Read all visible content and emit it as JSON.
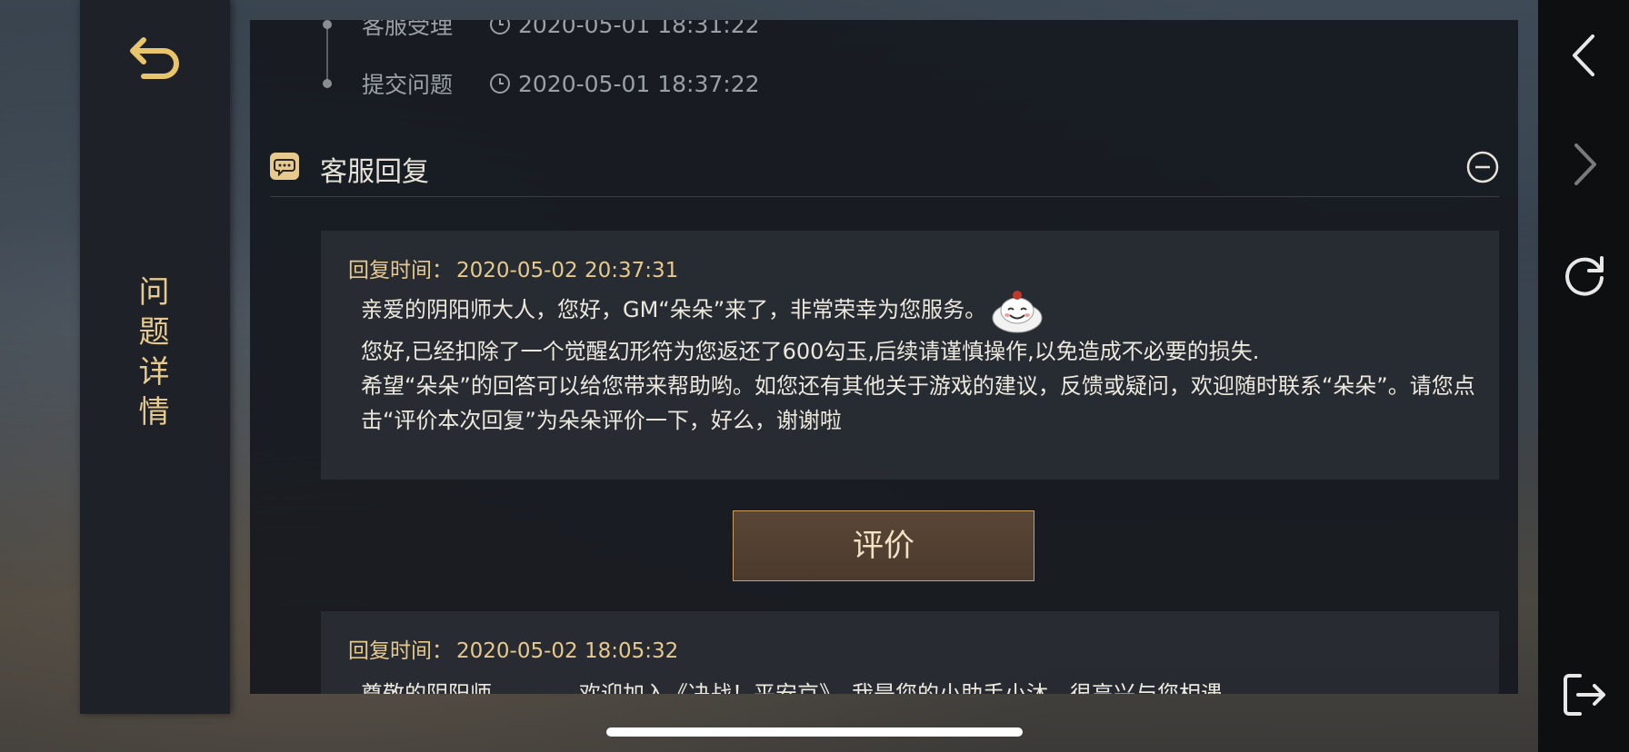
{
  "left_nav": {
    "back_icon": "back-arrow-icon",
    "title_chars": [
      "问",
      "题",
      "详",
      "情"
    ]
  },
  "timeline": {
    "items": [
      {
        "label": "客服受理",
        "time": "2020-05-01 18:31:22"
      },
      {
        "label": "提交问题",
        "time": "2020-05-01 18:37:22"
      }
    ]
  },
  "section": {
    "title": "客服回复",
    "icon": "chat-bubble-icon",
    "collapse_icon": "minus-circle-icon"
  },
  "replies": [
    {
      "time_label": "回复时间：",
      "time": "2020-05-02 20:37:31",
      "lines": [
        "亲爱的阴阳师大人，您好，GM“朵朵”来了，非常荣幸为您服务。",
        "您好,已经扣除了一个觉醒幻形符为您返还了600勾玉,后续请谨慎操作,以免造成不必要的损失.",
        "希望“朵朵”的回答可以给您带来帮助哟。如您还有其他关于游戏的建议，反馈或疑问，欢迎随时联系“朵朵”。请您点击“评价本次回复”为朵朵评价一下，好么，谢谢啦"
      ]
    },
    {
      "time_label": "回复时间：",
      "time": "2020-05-02 18:05:32",
      "lines": [
        "尊敬的阴阳师　　　，欢迎加入《决战！平安京》，我是您的小助手小沐，很高兴与您相遇"
      ]
    }
  ],
  "rate_button": {
    "label": "评价"
  },
  "system_bar": {
    "icons": [
      "chevron-left-icon",
      "chevron-right-icon",
      "refresh-icon",
      "exit-icon"
    ]
  },
  "colors": {
    "accent_gold": "#e6c98c",
    "panel_bg": "#16191f",
    "button_bg": "#54412f"
  }
}
